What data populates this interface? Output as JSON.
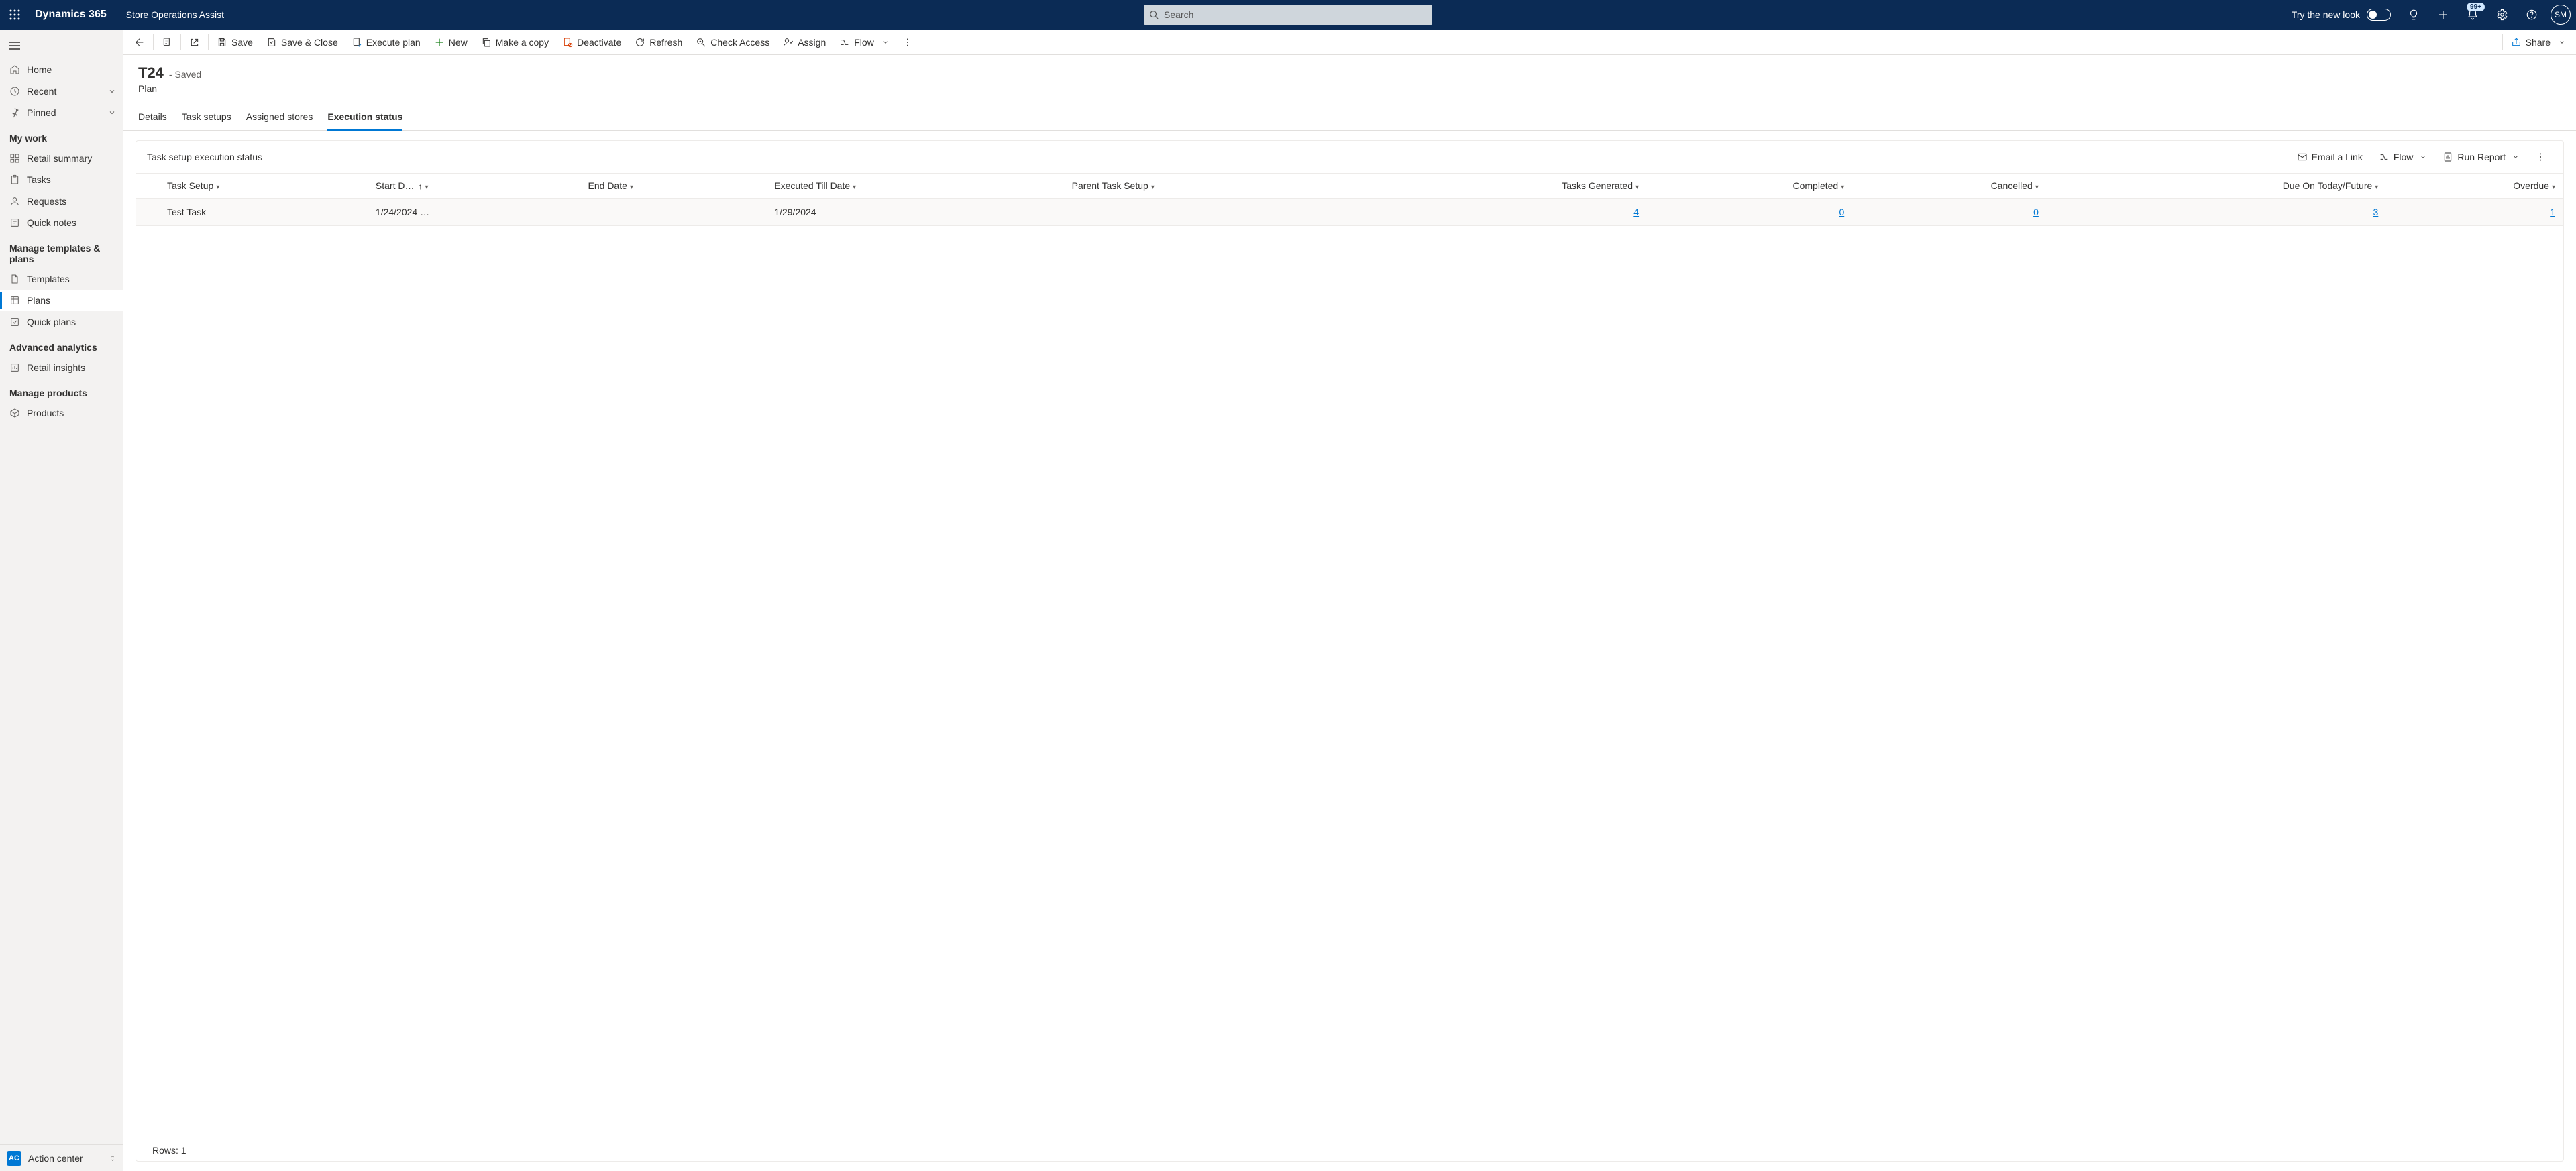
{
  "header": {
    "brand": "Dynamics 365",
    "app": "Store Operations Assist",
    "search_placeholder": "Search",
    "try_new_look": "Try the new look",
    "notification_badge": "99+",
    "avatar_initials": "SM"
  },
  "sidebar": {
    "home": "Home",
    "recent": "Recent",
    "pinned": "Pinned",
    "groups": {
      "my_work": {
        "label": "My work",
        "items": {
          "retail_summary": "Retail summary",
          "tasks": "Tasks",
          "requests": "Requests",
          "quick_notes": "Quick notes"
        }
      },
      "manage_templates": {
        "label": "Manage templates & plans",
        "items": {
          "templates": "Templates",
          "plans": "Plans",
          "quick_plans": "Quick plans"
        }
      },
      "advanced_analytics": {
        "label": "Advanced analytics",
        "items": {
          "retail_insights": "Retail insights"
        }
      },
      "manage_products": {
        "label": "Manage products",
        "items": {
          "products": "Products"
        }
      }
    },
    "footer": {
      "badge": "AC",
      "label": "Action center"
    }
  },
  "commandbar": {
    "save": "Save",
    "save_close": "Save & Close",
    "execute_plan": "Execute plan",
    "new": "New",
    "make_copy": "Make a copy",
    "deactivate": "Deactivate",
    "refresh": "Refresh",
    "check_access": "Check Access",
    "assign": "Assign",
    "flow": "Flow",
    "share": "Share"
  },
  "record": {
    "title": "T24",
    "state": "- Saved",
    "entity": "Plan",
    "tabs": {
      "details": "Details",
      "task_setups": "Task setups",
      "assigned_stores": "Assigned stores",
      "execution_status": "Execution status"
    }
  },
  "section": {
    "title": "Task setup execution status",
    "actions": {
      "email_link": "Email a Link",
      "flow": "Flow",
      "run_report": "Run Report"
    }
  },
  "table": {
    "columns": {
      "task_setup": "Task Setup",
      "start_date": "Start D…",
      "end_date": "End Date",
      "executed_till": "Executed Till Date",
      "parent_task_setup": "Parent Task Setup",
      "tasks_generated": "Tasks Generated",
      "completed": "Completed",
      "cancelled": "Cancelled",
      "due_today_future": "Due On Today/Future",
      "overdue": "Overdue"
    },
    "rows": [
      {
        "task_setup": "Test Task",
        "start_date": "1/24/2024 …",
        "end_date": "",
        "executed_till": "1/29/2024",
        "parent_task_setup": "",
        "tasks_generated": "4",
        "completed": "0",
        "cancelled": "0",
        "due_today_future": "3",
        "overdue": "1"
      }
    ],
    "rows_label": "Rows: 1"
  }
}
